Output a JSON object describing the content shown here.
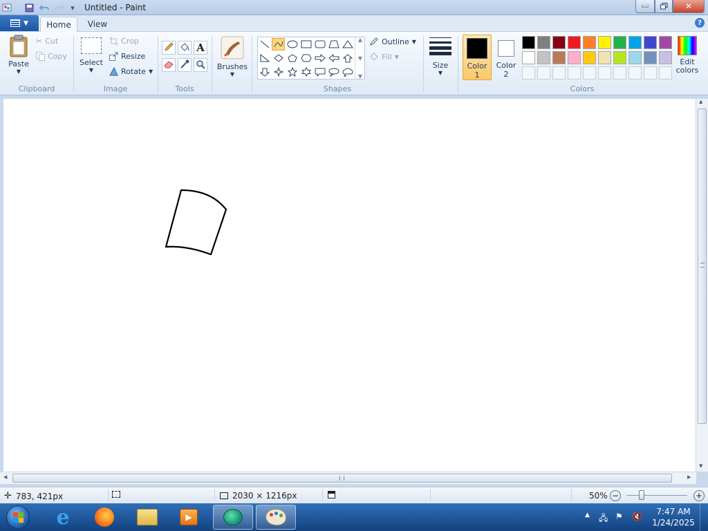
{
  "window": {
    "title": "Untitled - Paint"
  },
  "tabs": {
    "home": "Home",
    "view": "View"
  },
  "ribbon": {
    "clipboard": {
      "group": "Clipboard",
      "paste": "Paste",
      "cut": "Cut",
      "copy": "Copy"
    },
    "image": {
      "group": "Image",
      "select": "Select",
      "crop": "Crop",
      "resize": "Resize",
      "rotate": "Rotate"
    },
    "tools": {
      "group": "Tools"
    },
    "brushes": {
      "label": "Brushes"
    },
    "shapes": {
      "group": "Shapes",
      "outline": "Outline",
      "fill": "Fill"
    },
    "size": {
      "label": "Size"
    },
    "colors": {
      "group": "Colors",
      "color1": "Color",
      "color1_num": "1",
      "color2": "Color",
      "color2_num": "2",
      "edit": "Edit",
      "edit2": "colors",
      "color1_value": "#000000",
      "color2_value": "#ffffff",
      "palette_row1": [
        "#000000",
        "#7f7f7f",
        "#880015",
        "#ed1c24",
        "#ff7f27",
        "#fff200",
        "#22b14c",
        "#00a2e8",
        "#3f48cc",
        "#a349a4"
      ],
      "palette_row2": [
        "#ffffff",
        "#c3c3c3",
        "#b97a57",
        "#ffaec9",
        "#ffc90e",
        "#efe4b0",
        "#b5e61d",
        "#99d9ea",
        "#7092be",
        "#c8bfe7"
      ]
    }
  },
  "statusbar": {
    "cursor": "783, 421px",
    "canvas_size": "2030 × 1216px",
    "zoom": "50%"
  },
  "taskbar": {
    "time": "7:47 AM",
    "date": "1/24/2025"
  }
}
